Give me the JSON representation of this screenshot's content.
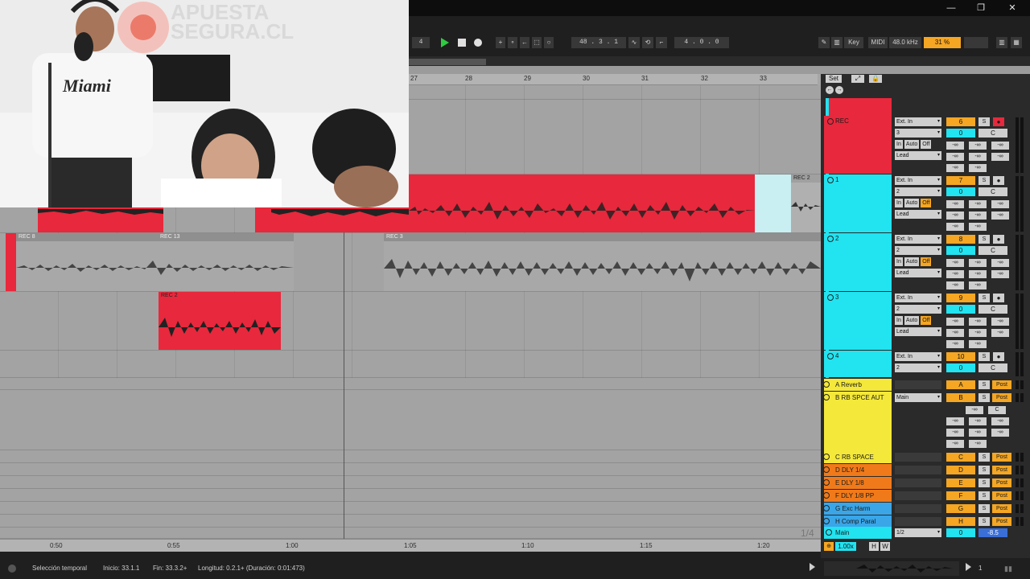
{
  "window": {
    "minimize": "—",
    "maximize": "❐",
    "close": "✕"
  },
  "transport": {
    "left_field": "4",
    "position": "48 .  3 .  1",
    "loop_length": "4 .  0 .  0",
    "key_label": "Key",
    "midi_label": "MIDI",
    "sample_rate": "48.0 kHz",
    "cpu": "31 %"
  },
  "ruler": {
    "bars": [
      "27",
      "28",
      "29",
      "30",
      "31",
      "32",
      "33"
    ]
  },
  "arrangement": {
    "set_button": "Set",
    "clips": {
      "rec2_right": "REC 2",
      "rec8": "REC 8",
      "rec13": "REC 13",
      "rec3": "REC 3",
      "rec2_lower": "REC 2"
    }
  },
  "time_ruler": {
    "times": [
      "0:50",
      "0:55",
      "1:00",
      "1:05",
      "1:10",
      "1:15",
      "1:20"
    ],
    "zoom_label": "1/4"
  },
  "tracks": [
    {
      "name": "REC",
      "color": "#e8283c",
      "input": "Ext. In",
      "channel": "3",
      "out": "Lead",
      "number": "6",
      "vol": "0",
      "pan": "C",
      "armed": true
    },
    {
      "name": "1",
      "color": "#22e3f0",
      "input": "Ext. In",
      "channel": "2",
      "out": "Lead",
      "number": "7",
      "vol": "0",
      "pan": "C",
      "armed": false
    },
    {
      "name": "2",
      "color": "#22e3f0",
      "input": "Ext. In",
      "channel": "2",
      "out": "Lead",
      "number": "8",
      "vol": "0",
      "pan": "C",
      "armed": false
    },
    {
      "name": "3",
      "color": "#22e3f0",
      "input": "Ext. In",
      "channel": "2",
      "out": "Lead",
      "number": "9",
      "vol": "0",
      "pan": "C",
      "armed": false
    },
    {
      "name": "4",
      "color": "#22e3f0",
      "input": "Ext. In",
      "channel": "2",
      "out": "",
      "number": "10",
      "vol": "0",
      "pan": "C",
      "armed": false
    }
  ],
  "monitor": {
    "in": "In",
    "auto": "Auto",
    "off": "Off"
  },
  "mixer_labels": {
    "solo": "S",
    "inf": "-∞",
    "post": "Post"
  },
  "returns": [
    {
      "name": "A Reverb",
      "letter": "A",
      "color": "#f4e83a"
    },
    {
      "name": "B RB SPCE AUT",
      "letter": "B",
      "color": "#f4e83a",
      "output": "Main"
    },
    {
      "name": "C RB SPACE",
      "letter": "C",
      "color": "#f4e83a"
    },
    {
      "name": "D DLY 1/4",
      "letter": "D",
      "color": "#f07a1a"
    },
    {
      "name": "E DLY 1/8",
      "letter": "E",
      "color": "#f07a1a"
    },
    {
      "name": "F DLY 1/8 PP",
      "letter": "F",
      "color": "#f07a1a"
    },
    {
      "name": "G Exc Harm",
      "letter": "G",
      "color": "#3aa6e8"
    },
    {
      "name": "H Comp Paral",
      "letter": "H",
      "color": "#3aa6e8"
    }
  ],
  "main": {
    "name": "Main",
    "input": "1/2",
    "vol": "0",
    "level": "-8.5",
    "color": "#22e3f0"
  },
  "mixer_footer": {
    "tempo_scale": "1.00x",
    "h": "H",
    "w": "W"
  },
  "status": {
    "selection": "Selección temporal",
    "start": "Inicio: 33.1.1",
    "end": "Fin: 33.3.2+",
    "length": "Longitud: 0.2.1+ (Duración: 0:01:473)",
    "page": "1"
  },
  "webcam": {
    "sign_text_1": "APUESTA",
    "sign_text_2": "SEGURA.CL",
    "shirt_text": "Miami"
  }
}
